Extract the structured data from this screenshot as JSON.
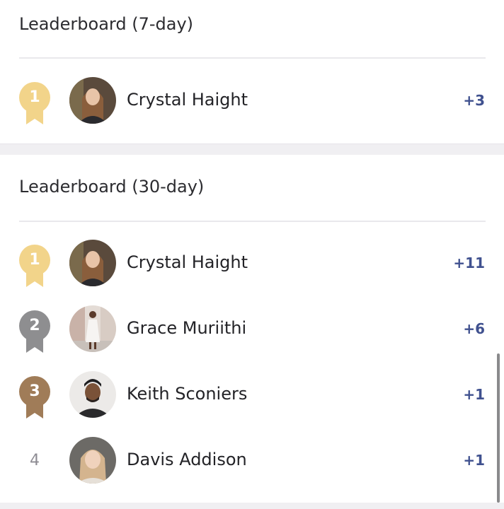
{
  "colors": {
    "gold": "#f2d48a",
    "silver": "#8e8e90",
    "bronze": "#a07c58",
    "score": "#40518f"
  },
  "leaderboard_7day": {
    "title": "Leaderboard (7-day)",
    "entries": [
      {
        "rank": "1",
        "medal": "gold",
        "name": "Crystal Haight",
        "score": "+3",
        "avatar": "avatar-crystal"
      }
    ]
  },
  "leaderboard_30day": {
    "title": "Leaderboard (30-day)",
    "entries": [
      {
        "rank": "1",
        "medal": "gold",
        "name": "Crystal Haight",
        "score": "+11",
        "avatar": "avatar-crystal"
      },
      {
        "rank": "2",
        "medal": "silver",
        "name": "Grace Muriithi",
        "score": "+6",
        "avatar": "avatar-grace"
      },
      {
        "rank": "3",
        "medal": "bronze",
        "name": "Keith Sconiers",
        "score": "+1",
        "avatar": "avatar-keith"
      },
      {
        "rank": "4",
        "medal": "none",
        "name": "Davis Addison",
        "score": "+1",
        "avatar": "avatar-davis"
      }
    ]
  }
}
